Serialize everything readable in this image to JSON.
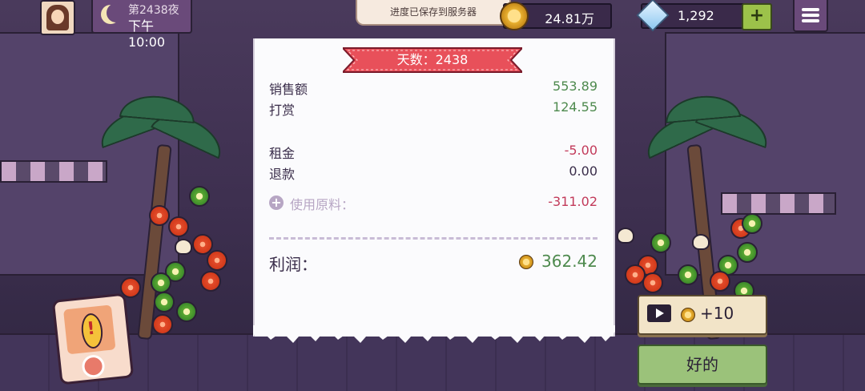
{
  "hud": {
    "day_label": "第2438夜",
    "time": "下午10:00",
    "toast": "进度已保存到服务器",
    "coins": "24.81万",
    "gems": "1,292",
    "add_label": "+"
  },
  "receipt": {
    "title": "天数：2438",
    "rows": [
      {
        "label": "销售额",
        "value": "553.89"
      },
      {
        "label": "打赏",
        "value": "124.55"
      },
      {
        "label": "租金",
        "value": "-5.00"
      },
      {
        "label": "退款",
        "value": "0.00"
      },
      {
        "label": "使用原料：",
        "value": "-311.02"
      }
    ],
    "profit_label": "利润：",
    "profit_value": "362.42"
  },
  "buttons": {
    "ad_reward": "+10",
    "ok": "好的"
  },
  "colors": {
    "positive": "#4e8a4e",
    "negative": "#c23a5a",
    "ribbon": "#e8505a",
    "ok_button": "#9bc27a"
  }
}
